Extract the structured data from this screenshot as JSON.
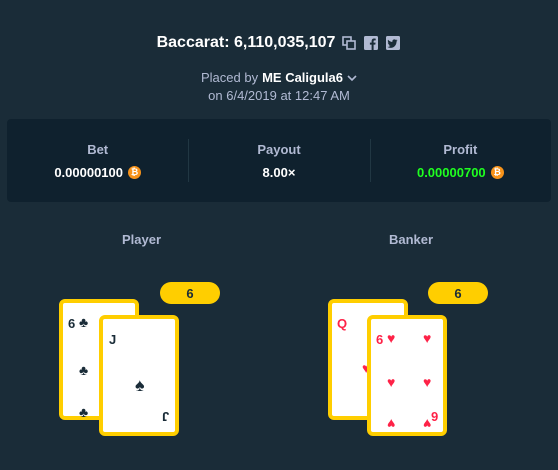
{
  "header": {
    "title": "Baccarat: 6,110,035,107",
    "placed_by_prefix": "Placed by",
    "user": "ME Caligula6",
    "date": "on 6/4/2019 at 12:47 AM"
  },
  "stats": {
    "bet_label": "Bet",
    "bet_value": "0.00000100",
    "payout_label": "Payout",
    "payout_value": "8.00×",
    "profit_label": "Profit",
    "profit_value": "0.00000700",
    "coin_symbol": "₿"
  },
  "player": {
    "label": "Player",
    "score": "6",
    "cards": [
      {
        "rank": "6",
        "suit": "club"
      },
      {
        "rank": "J",
        "suit": "spade"
      }
    ]
  },
  "banker": {
    "label": "Banker",
    "score": "6",
    "cards": [
      {
        "rank": "Q",
        "suit": "heart"
      },
      {
        "rank": "6",
        "suit": "heart"
      }
    ]
  },
  "colors": {
    "background": "#1a2c38",
    "panel": "#0f212e",
    "accent_yellow": "#ffce00",
    "profit_green": "#1fff20",
    "card_red": "#fe2247",
    "coin_orange": "#f7931a"
  },
  "icons": [
    "copy-icon",
    "facebook-icon",
    "twitter-icon",
    "chevron-down-icon",
    "bitcoin-icon"
  ]
}
